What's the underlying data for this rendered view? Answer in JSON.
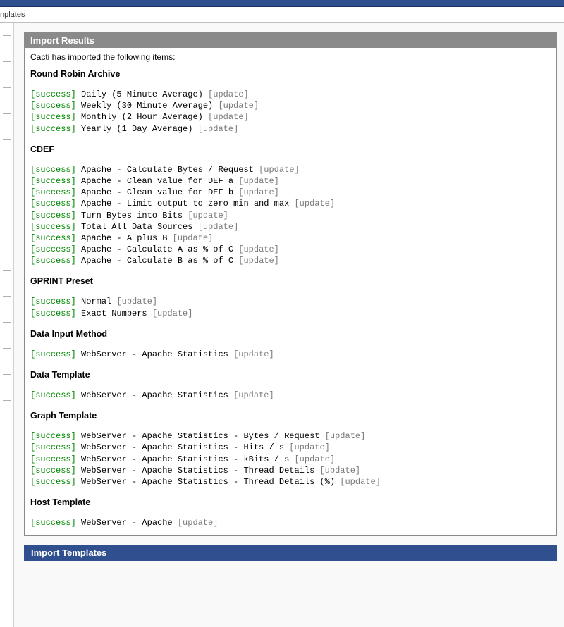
{
  "tabLabel": "nplates",
  "panel": {
    "title": "Import Results",
    "intro": "Cacti has imported the following items:"
  },
  "nextPanel": {
    "title": "Import Templates"
  },
  "statusToken": "[success]",
  "noteToken": "[update]",
  "sections": [
    {
      "title": "Round Robin Archive",
      "items": [
        "Daily (5 Minute Average)",
        "Weekly (30 Minute Average)",
        "Monthly (2 Hour Average)",
        "Yearly (1 Day Average)"
      ]
    },
    {
      "title": "CDEF",
      "items": [
        "Apache - Calculate Bytes / Request",
        "Apache - Clean value for DEF a",
        "Apache - Clean value for DEF b",
        "Apache - Limit output to zero min and max",
        "Turn Bytes into Bits",
        "Total All Data Sources",
        "Apache - A plus B",
        "Apache - Calculate A as % of C",
        "Apache - Calculate B as % of C"
      ]
    },
    {
      "title": "GPRINT Preset",
      "items": [
        "Normal",
        "Exact Numbers"
      ]
    },
    {
      "title": "Data Input Method",
      "items": [
        "WebServer - Apache Statistics"
      ]
    },
    {
      "title": "Data Template",
      "items": [
        "WebServer - Apache Statistics"
      ]
    },
    {
      "title": "Graph Template",
      "items": [
        "WebServer - Apache Statistics - Bytes / Request",
        "WebServer - Apache Statistics - Hits / s",
        "WebServer - Apache Statistics - kBits / s",
        "WebServer - Apache Statistics - Thread Details",
        "WebServer - Apache Statistics - Thread Details (%)"
      ]
    },
    {
      "title": "Host Template",
      "items": [
        "WebServer - Apache"
      ]
    }
  ]
}
